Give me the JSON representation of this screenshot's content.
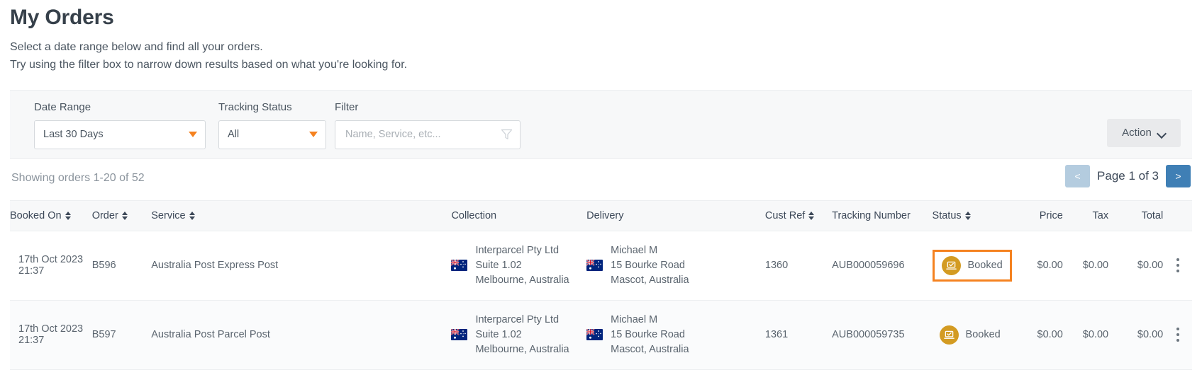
{
  "header": {
    "title": "My Orders",
    "intro_line_1": "Select a date range below and find all your orders.",
    "intro_line_2": "Try using the filter box to narrow down results based on what you're looking for."
  },
  "filters": {
    "date_range_label": "Date Range",
    "date_range_value": "Last 30 Days",
    "tracking_status_label": "Tracking Status",
    "tracking_status_value": "All",
    "filter_label": "Filter",
    "filter_value": "",
    "filter_placeholder": "Name, Service, etc...",
    "action_label": "Action",
    "caret_icon": "caret-down-icon",
    "funnel_icon": "funnel-icon",
    "chevron_icon": "chevron-down-icon"
  },
  "results": {
    "showing_text": "Showing orders 1-20 of 52",
    "prev_label": "<",
    "next_label": ">",
    "page_label": "Page 1 of 3"
  },
  "table": {
    "columns": [
      {
        "label": "Booked On",
        "sortable": true
      },
      {
        "label": "Order",
        "sortable": true
      },
      {
        "label": "Service",
        "sortable": true
      },
      {
        "label": "Collection",
        "sortable": false
      },
      {
        "label": "Delivery",
        "sortable": false
      },
      {
        "label": "Cust Ref",
        "sortable": true
      },
      {
        "label": "Tracking Number",
        "sortable": false
      },
      {
        "label": "Status",
        "sortable": true
      },
      {
        "label": "Price",
        "sortable": false
      },
      {
        "label": "Tax",
        "sortable": false
      },
      {
        "label": "Total",
        "sortable": false
      },
      {
        "label": "",
        "sortable": false
      }
    ],
    "rows": [
      {
        "booked_on_date": "17th Oct 2023",
        "booked_on_time": "21:37",
        "order": "B596",
        "service": "Australia Post Express Post",
        "collection": {
          "flag": "australia-flag-icon",
          "line1": "Interparcel Pty Ltd",
          "line2": "Suite 1.02",
          "line3": "Melbourne, Australia"
        },
        "delivery": {
          "flag": "australia-flag-icon",
          "line1": "Michael M",
          "line2": "15 Bourke Road",
          "line3": "Mascot, Australia"
        },
        "cust_ref": "1360",
        "tracking_number": "AUB000059696",
        "status": "Booked",
        "status_icon": "booked-parcel-icon",
        "status_highlighted": true,
        "price": "$0.00",
        "tax": "$0.00",
        "total": "$0.00",
        "menu_icon": "kebab-menu-icon"
      },
      {
        "booked_on_date": "17th Oct 2023",
        "booked_on_time": "21:37",
        "order": "B597",
        "service": "Australia Post Parcel Post",
        "collection": {
          "flag": "australia-flag-icon",
          "line1": "Interparcel Pty Ltd",
          "line2": "Suite 1.02",
          "line3": "Melbourne, Australia"
        },
        "delivery": {
          "flag": "australia-flag-icon",
          "line1": "Michael M",
          "line2": "15 Bourke Road",
          "line3": "Mascot, Australia"
        },
        "cust_ref": "1361",
        "tracking_number": "AUB000059735",
        "status": "Booked",
        "status_icon": "booked-parcel-icon",
        "status_highlighted": false,
        "price": "$0.00",
        "tax": "$0.00",
        "total": "$0.00",
        "menu_icon": "kebab-menu-icon"
      }
    ]
  },
  "colors": {
    "accent_orange": "#f58220",
    "status_gold": "#d39b22",
    "next_blue": "#3f7fb5",
    "prev_blue": "#b4ccdf"
  }
}
